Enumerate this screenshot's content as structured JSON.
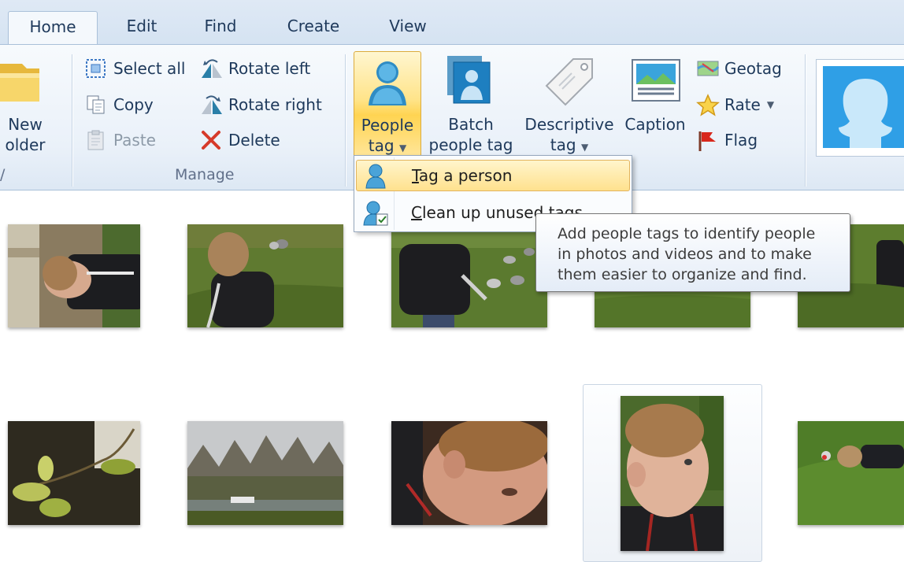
{
  "tabs": [
    "Home",
    "Edit",
    "Find",
    "Create",
    "View"
  ],
  "ribbon": {
    "new_folder": {
      "line1": "New",
      "line2": "older"
    },
    "group_partial_label": "/",
    "manage": {
      "select_all": "Select all",
      "copy": "Copy",
      "paste": "Paste",
      "rotate_left": "Rotate left",
      "rotate_right": "Rotate right",
      "delete": "Delete",
      "group_label": "Manage"
    },
    "people_tag": {
      "line1": "People",
      "line2": "tag"
    },
    "batch_people_tag": {
      "line1": "Batch",
      "line2": "people tag"
    },
    "descriptive_tag": {
      "line1": "Descriptive",
      "line2": "tag"
    },
    "caption": "Caption",
    "geotag": "Geotag",
    "rate": "Rate",
    "flag": "Flag"
  },
  "people_tag_menu": {
    "item1": {
      "access_key": "T",
      "rest": "ag a person"
    },
    "item2": {
      "access_key": "C",
      "rest": "lean up unused tags"
    }
  },
  "tooltip": {
    "line1": "Add people tags to identify people",
    "line2": "in photos and videos and to make",
    "line3": "them easier to organize and find."
  },
  "icons": {
    "people_tag": "person-tag-icon",
    "batch": "batch-person-icon",
    "descriptive": "tag-icon",
    "caption": "caption-icon",
    "geotag": "map-icon",
    "rate": "star-icon",
    "flag": "flag-icon",
    "delete": "delete-x-icon"
  },
  "photos": {
    "row1": [
      "toddler-at-wall",
      "toddler-walking-to-pigeons",
      "toddler-feeding-pigeons",
      "grass",
      "toddler-edge"
    ],
    "row2": [
      "leaf-buds",
      "park-pond",
      "toddler-closeup",
      "toddler-portrait-selected",
      "toddler-in-grass"
    ]
  }
}
